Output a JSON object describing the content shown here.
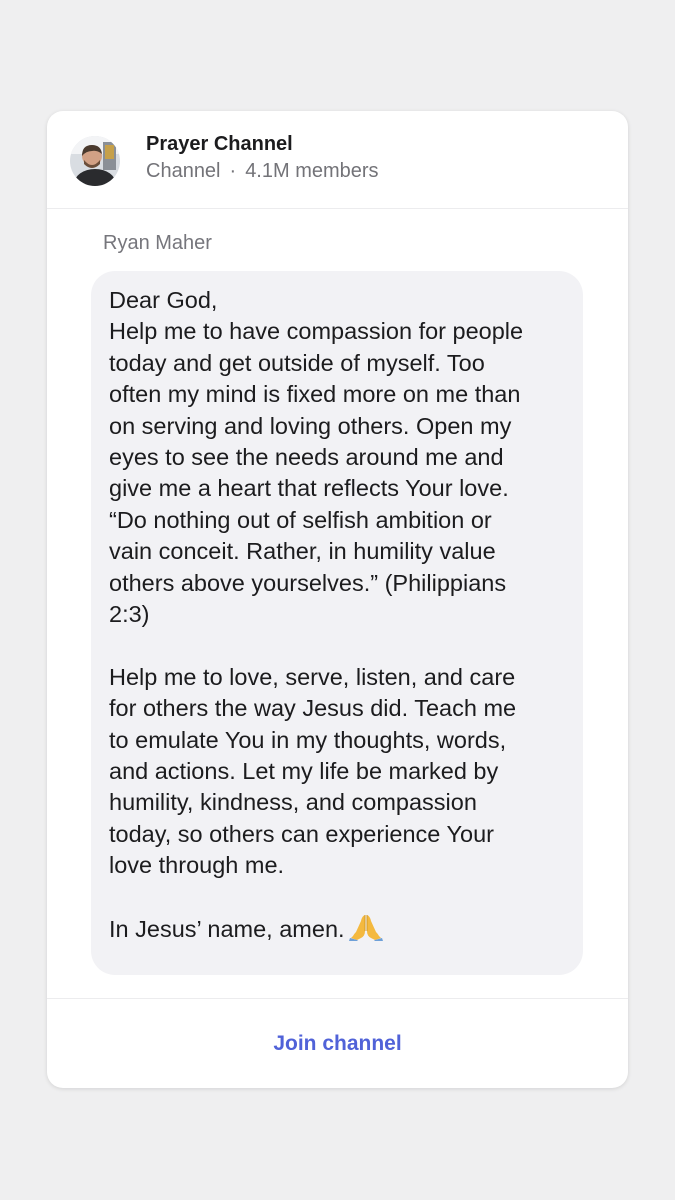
{
  "channel": {
    "name": "Prayer Channel",
    "type_label": "Channel",
    "separator": "·",
    "members": "4.1M members",
    "avatar_icon": "profile-photo-avatar"
  },
  "message": {
    "sender": "Ryan Maher",
    "lines": [
      "Dear God,",
      "Help me to have compassion for people",
      "today and get outside of myself. Too",
      "often my mind is fixed more on me than",
      "on serving and loving others. Open my",
      "eyes to see the needs around me and",
      "give me a heart that reflects Your love.",
      "“Do nothing out of selfish ambition or",
      "vain conceit. Rather, in humility value",
      "others above yourselves.” (Philippians",
      "2:3)",
      "",
      "Help me to love, serve, listen, and care",
      "for others the way Jesus did. Teach me",
      "to emulate You in my thoughts, words,",
      "and actions. Let my life be marked by",
      "humility, kindness, and compassion",
      "today, so others can experience Your",
      "love through me.",
      "",
      "In Jesus’ name, amen."
    ],
    "emoji_icon": "praying-hands-icon"
  },
  "footer": {
    "join_label": "Join channel"
  },
  "colors": {
    "page_background": "#efeff0",
    "card_background": "#ffffff",
    "bubble_background": "#f2f2f5",
    "accent": "#5062d8",
    "secondary_text": "#737378"
  }
}
